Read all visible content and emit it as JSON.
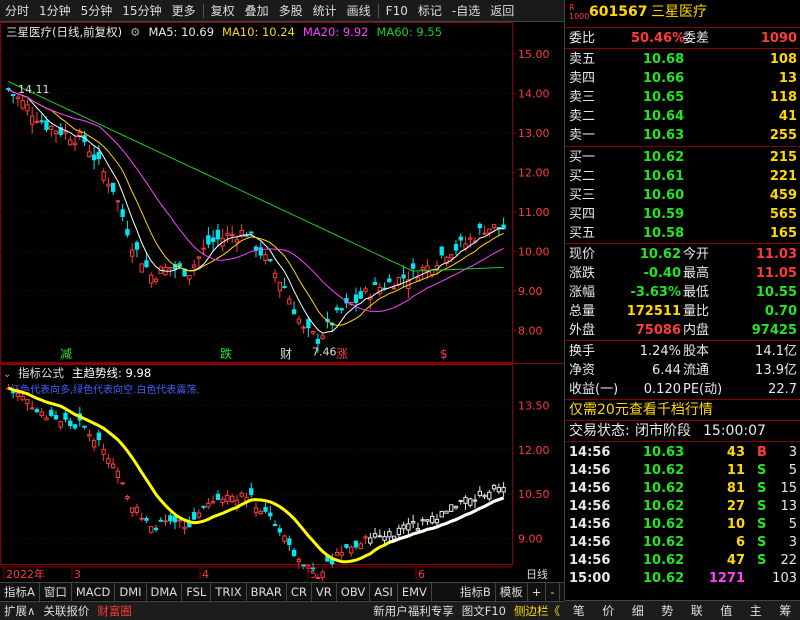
{
  "toolbar": {
    "items": [
      "分时",
      "1分钟",
      "5分钟",
      "15分钟",
      "更多",
      "复权",
      "叠加",
      "多股",
      "统计",
      "画线",
      "F10",
      "标记",
      "-自选",
      "返回"
    ]
  },
  "chart_header": {
    "name": "三星医疗(日线,前复权)",
    "ma5": "MA5: 10.69",
    "ma10": "MA10: 10.24",
    "ma20": "MA20: 9.92",
    "ma60": "MA60: 9.55"
  },
  "price_axis": [
    "15.00",
    "14.00",
    "13.00",
    "12.00",
    "11.00",
    "10.00",
    "9.00",
    "8.00"
  ],
  "markers": {
    "high": "14.11",
    "low": "7.46",
    "label_jian": "减",
    "label_die": "跌",
    "label_cai": "财",
    "label_zhang": "涨",
    "label_s": "$"
  },
  "indicator": {
    "title": "指标公式",
    "line_label": "主趋势线: 9.98",
    "subtitle": "红色代表向多,绿色代表向空.白色代表震荡.",
    "axis": [
      "13.50",
      "12.00",
      "10.50",
      "9.00"
    ]
  },
  "date_axis": {
    "labels": [
      "2022年",
      "3",
      "4",
      "5",
      "6"
    ],
    "right_label": "日线"
  },
  "bottom_tabs": [
    "指标A",
    "窗口",
    "MACD",
    "DMI",
    "DMA",
    "FSL",
    "TRIX",
    "BRAR",
    "CR",
    "VR",
    "OBV",
    "ASI",
    "EMV",
    "指标B",
    "模板",
    "+",
    "-"
  ],
  "status_bar": {
    "left": [
      "扩展∧",
      "关联报价",
      "财富圈"
    ],
    "right": [
      "新用户福利专享",
      "图文F10",
      "侧边栏《"
    ]
  },
  "quote": {
    "code": "601567",
    "name": "三星医疗",
    "weibi_label": "委比",
    "weibi": "50.46%",
    "weicha_label": "委差",
    "weicha": "1090",
    "sells": [
      {
        "label": "卖五",
        "price": "10.68",
        "vol": "108"
      },
      {
        "label": "卖四",
        "price": "10.66",
        "vol": "13"
      },
      {
        "label": "卖三",
        "price": "10.65",
        "vol": "118"
      },
      {
        "label": "卖二",
        "price": "10.64",
        "vol": "41"
      },
      {
        "label": "卖一",
        "price": "10.63",
        "vol": "255"
      }
    ],
    "buys": [
      {
        "label": "买一",
        "price": "10.62",
        "vol": "215"
      },
      {
        "label": "买二",
        "price": "10.61",
        "vol": "221"
      },
      {
        "label": "买三",
        "price": "10.60",
        "vol": "459"
      },
      {
        "label": "买四",
        "price": "10.59",
        "vol": "565"
      },
      {
        "label": "买五",
        "price": "10.58",
        "vol": "165"
      }
    ],
    "stats": [
      [
        {
          "l": "现价",
          "v": "10.62",
          "c": "green"
        },
        {
          "l": "今开",
          "v": "11.03",
          "c": "red"
        }
      ],
      [
        {
          "l": "涨跌",
          "v": "-0.40",
          "c": "green"
        },
        {
          "l": "最高",
          "v": "11.05",
          "c": "red"
        }
      ],
      [
        {
          "l": "涨幅",
          "v": "-3.63%",
          "c": "green"
        },
        {
          "l": "最低",
          "v": "10.55",
          "c": "green"
        }
      ],
      [
        {
          "l": "总量",
          "v": "172511",
          "c": "yellow"
        },
        {
          "l": "量比",
          "v": "0.70",
          "c": "green"
        }
      ],
      [
        {
          "l": "外盘",
          "v": "75086",
          "c": "red"
        },
        {
          "l": "内盘",
          "v": "97425",
          "c": "green"
        }
      ]
    ],
    "stats2": [
      [
        {
          "l": "换手",
          "v": "1.24%"
        },
        {
          "l": "股本",
          "v": "14.1亿"
        }
      ],
      [
        {
          "l": "净资",
          "v": "6.44"
        },
        {
          "l": "流通",
          "v": "13.9亿"
        }
      ],
      [
        {
          "l": "收益(一)",
          "v": "0.120"
        },
        {
          "l": "PE(动)",
          "v": "22.7"
        }
      ]
    ],
    "promo": "仅需20元查看千档行情",
    "status_label": "交易状态:",
    "status_value": "闭市阶段",
    "status_time": "15:00:07",
    "ticks": [
      {
        "t": "14:56",
        "p": "10.63",
        "v": "43",
        "s": "B",
        "n": "3"
      },
      {
        "t": "14:56",
        "p": "10.62",
        "v": "11",
        "s": "S",
        "n": "5"
      },
      {
        "t": "14:56",
        "p": "10.62",
        "v": "81",
        "s": "S",
        "n": "15"
      },
      {
        "t": "14:56",
        "p": "10.62",
        "v": "27",
        "s": "S",
        "n": "13"
      },
      {
        "t": "14:56",
        "p": "10.62",
        "v": "10",
        "s": "S",
        "n": "5"
      },
      {
        "t": "14:56",
        "p": "10.62",
        "v": "6",
        "s": "S",
        "n": "3"
      },
      {
        "t": "14:56",
        "p": "10.62",
        "v": "47",
        "s": "S",
        "n": "22"
      },
      {
        "t": "15:00",
        "p": "10.62",
        "v": "1271",
        "s": "",
        "n": "103"
      }
    ],
    "bottom_icons": [
      "笔",
      "价",
      "细",
      "势",
      "联",
      "值",
      "主",
      "筹"
    ]
  },
  "colors": {
    "up": "#ff3a3a",
    "down": "#00e5ee",
    "ma5": "#ffffff",
    "ma10": "#ffd800",
    "ma20": "#ff40ff",
    "ma60": "#22cc22",
    "trend": "#ffff00"
  }
}
